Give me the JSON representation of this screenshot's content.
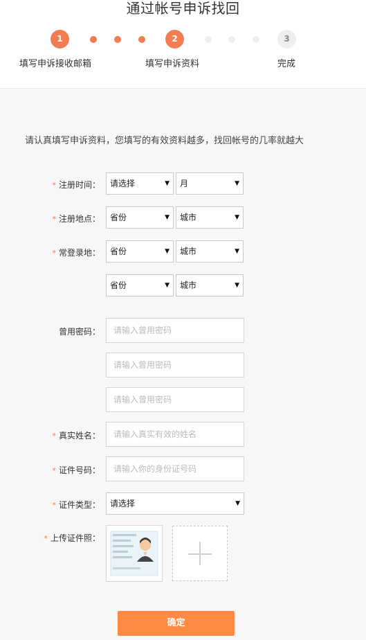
{
  "header": {
    "title": "通过帐号申诉找回",
    "steps": [
      {
        "number": "1",
        "label": "填写申诉接收邮箱"
      },
      {
        "number": "2",
        "label": "填写申诉资料"
      },
      {
        "number": "3",
        "label": "完成"
      }
    ]
  },
  "intro": "请认真填写申诉资料，您填写的有效资料越多，找回帐号的几率就越大",
  "form": {
    "reg_time": {
      "label": "注册时间：",
      "required_mark": "*",
      "select1": "请选择",
      "select2": "月"
    },
    "reg_place": {
      "label": "注册地点：",
      "required_mark": "*",
      "select1": "省份",
      "select2": "城市"
    },
    "login_place": {
      "label": "常登录地：",
      "required_mark": "*",
      "select1": "省份",
      "select2": "城市",
      "select3": "省份",
      "select4": "城市"
    },
    "old_password": {
      "label": "曾用密码：",
      "placeholder": "请输入曾用密码"
    },
    "real_name": {
      "label": "真实姓名：",
      "required_mark": "*",
      "placeholder": "请输入真实有效的姓名"
    },
    "id_number": {
      "label": "证件号码：",
      "required_mark": "*",
      "placeholder": "请输入你的身份证号码"
    },
    "id_type": {
      "label": "证件类型：",
      "required_mark": "*",
      "select": "请选择"
    },
    "id_photo": {
      "label": "上传证件照：",
      "required_mark": "*"
    }
  },
  "submit_label": "确定",
  "arrow_glyph": "▼",
  "colors": {
    "accent": "#f27d52",
    "button": "#ff8a44"
  }
}
